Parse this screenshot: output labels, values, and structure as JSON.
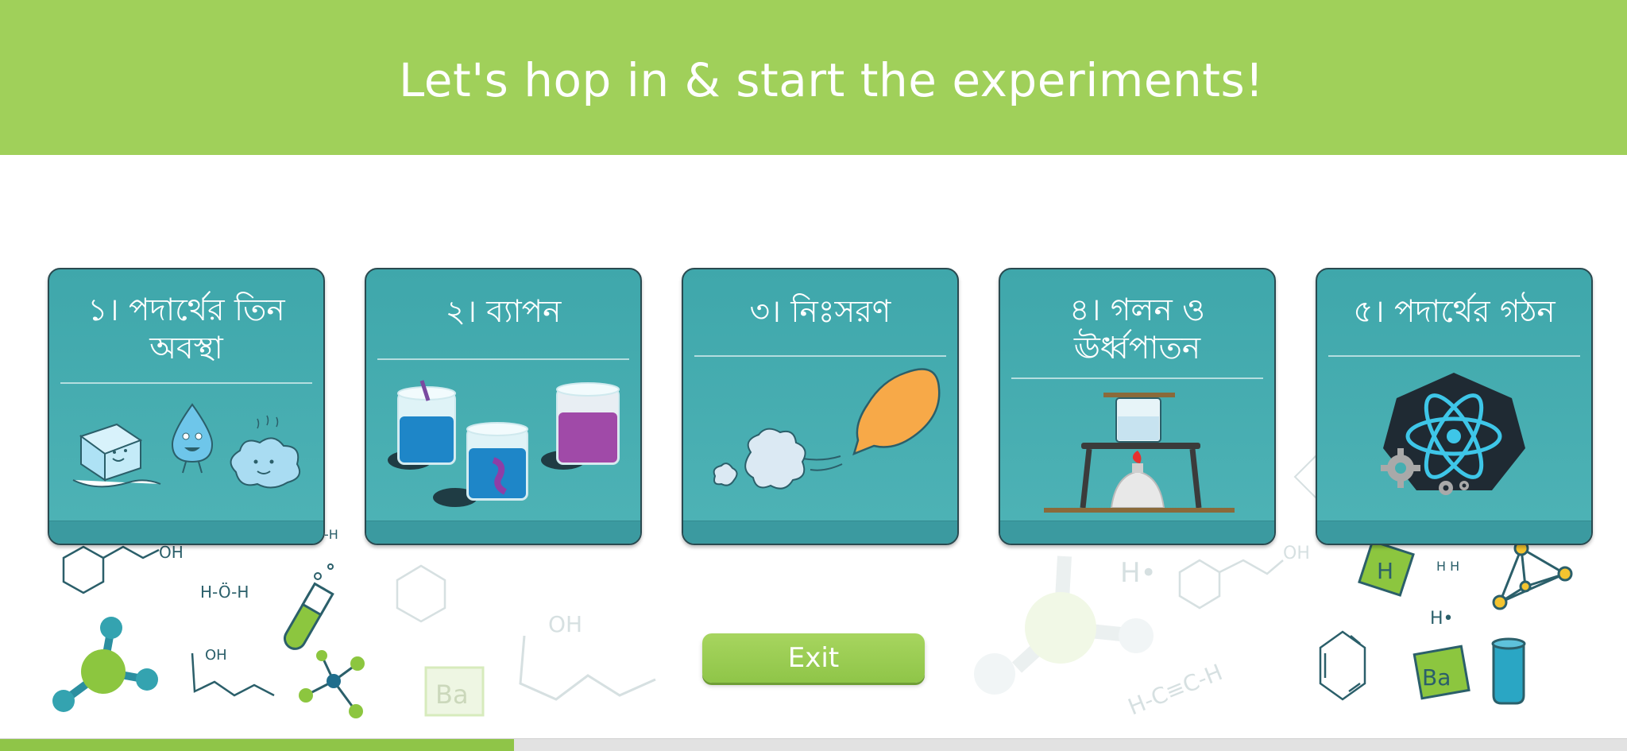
{
  "header": {
    "title": "Let's hop in & start the experiments!"
  },
  "cards": [
    {
      "title_line1": "১। পদার্থের তিন",
      "title_line2": "অবস্থা",
      "icon": "states-of-matter-icon"
    },
    {
      "title_line1": "২। ব্যাপন",
      "title_line2": "",
      "icon": "diffusion-beakers-icon"
    },
    {
      "title_line1": "৩। নিঃসরণ",
      "title_line2": "",
      "icon": "balloon-effusion-icon"
    },
    {
      "title_line1": "৪। গলন ও",
      "title_line2": "ঊর্ধ্বপাতন",
      "icon": "sublimation-stand-icon"
    },
    {
      "title_line1": "৫। পদার্থের গঠন",
      "title_line2": "",
      "icon": "atom-structure-icon"
    }
  ],
  "background_labels": {
    "oh_1": "OH",
    "water": "H-Ö-H",
    "oh_2": "OH",
    "ba_1": "Ba",
    "oh_3": "OH",
    "h_plus_1": "H•",
    "oh_4": "OH",
    "acetylene": "H-C≡C-H",
    "h_box": "H",
    "hh": "H H",
    "h_plus_2": "H•",
    "ba_2": "Ba",
    "h_small": "-H"
  },
  "exit_button": {
    "label": "Exit"
  },
  "progress": {
    "fraction": 0.316
  },
  "colors": {
    "header": "#a0d05a",
    "card": "#45aeb1",
    "button": "#9bcf52",
    "progress": "#8fc548"
  }
}
